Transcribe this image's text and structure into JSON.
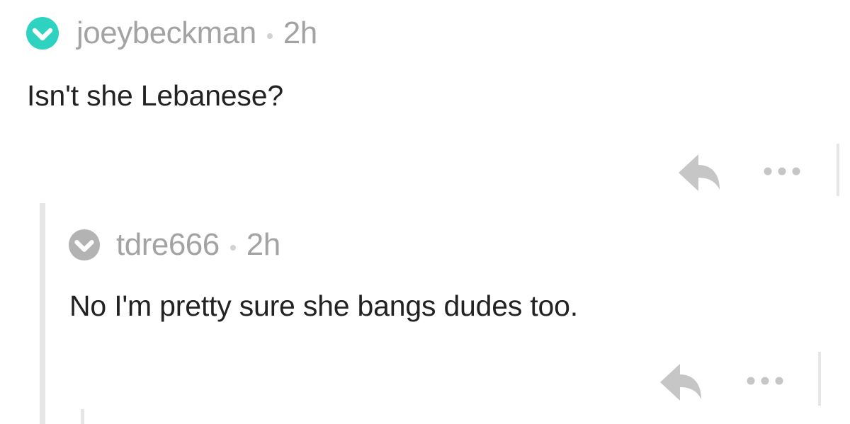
{
  "colors": {
    "verified_upvote": "#2dd3c0",
    "neutral_upvote": "#b3b3b3",
    "meta_text": "#a3a3a3",
    "body_text": "#222222",
    "icon_gray": "#c6c6c6",
    "thread_line": "#e6e6e6"
  },
  "comments": [
    {
      "username": "joeybeckman",
      "time": "2h",
      "body": "Isn't she Lebanese?",
      "vote_icon": "upvote-check-icon",
      "vote_state": "upvoted",
      "actions": {
        "reply_icon": "reply-arrow-icon",
        "more_icon": "more-dots-icon"
      }
    },
    {
      "username": "tdre666",
      "time": "2h",
      "body": "No I'm pretty sure she bangs dudes too.",
      "vote_icon": "upvote-check-icon",
      "vote_state": "neutral",
      "actions": {
        "reply_icon": "reply-arrow-icon",
        "more_icon": "more-dots-icon"
      }
    }
  ]
}
